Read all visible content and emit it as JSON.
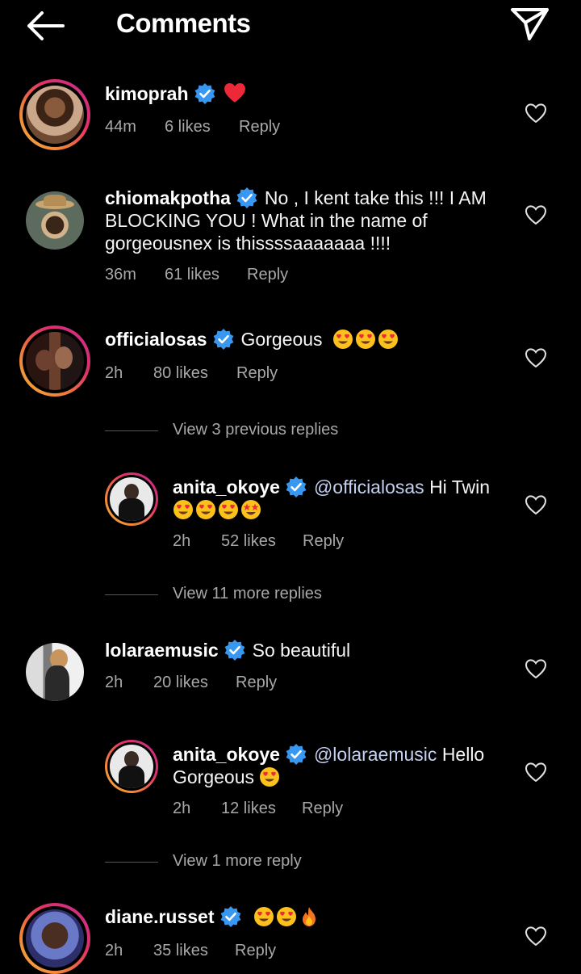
{
  "header": {
    "title": "Comments"
  },
  "comments": [
    {
      "username": "kimoprah",
      "text": "",
      "emojis": [
        "heart"
      ],
      "time": "44m",
      "likes": "6 likes",
      "reply": "Reply"
    },
    {
      "username": "chiomakpotha",
      "text": "No , I kent take this !!! I AM BLOCKING YOU ! What in the name of gorgeousnex is thissssaaaaaaa !!!!",
      "emojis": [],
      "time": "36m",
      "likes": "61 likes",
      "reply": "Reply"
    },
    {
      "username": "officialosas",
      "text": "Gorgeous",
      "emojis": [
        "heart-eyes",
        "heart-eyes",
        "heart-eyes"
      ],
      "time": "2h",
      "likes": "80 likes",
      "reply": "Reply"
    },
    {
      "username": "anita_okoye",
      "mention": "@officialosas",
      "text": "Hi Twin",
      "emojis": [
        "heart-eyes",
        "heart-eyes",
        "heart-eyes",
        "star-struck"
      ],
      "time": "2h",
      "likes": "52 likes",
      "reply": "Reply"
    },
    {
      "username": "lolaraemusic",
      "text": "So beautiful",
      "emojis": [],
      "time": "2h",
      "likes": "20 likes",
      "reply": "Reply"
    },
    {
      "username": "anita_okoye",
      "mention": "@lolaraemusic",
      "text": "Hello Gorgeous",
      "emojis": [
        "heart-eyes"
      ],
      "time": "2h",
      "likes": "12 likes",
      "reply": "Reply"
    },
    {
      "username": "diane.russet",
      "text": "",
      "emojis": [
        "heart-eyes",
        "heart-eyes",
        "fire"
      ],
      "time": "2h",
      "likes": "35 likes",
      "reply": "Reply"
    }
  ],
  "view_replies": [
    "View 3 previous replies",
    "View 11 more replies",
    "View 1 more reply"
  ],
  "colors": {
    "background": "#000000",
    "verified": "#3897f0",
    "secondary_text": "#a8a8a8",
    "heart": "#ed2939"
  }
}
